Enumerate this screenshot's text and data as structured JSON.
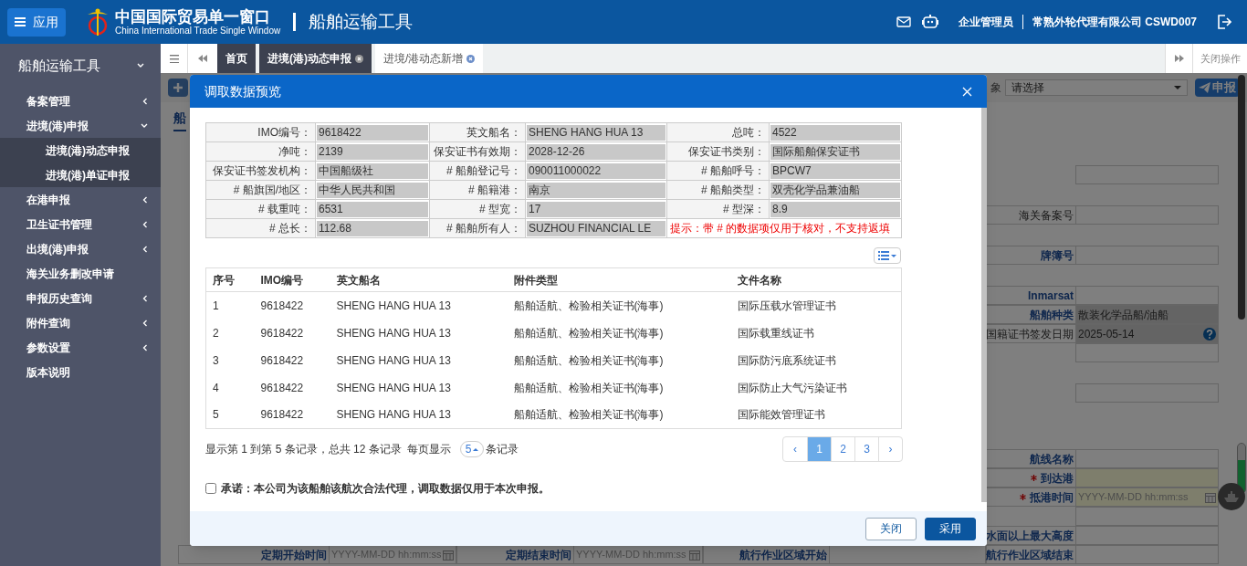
{
  "header": {
    "menu_button": "应用",
    "logo_cn": "中国国际贸易单一窗口",
    "logo_en": "China International Trade Single Window",
    "app_title": "船舶运输工具",
    "user_role": "企业管理员",
    "company": "常熟外轮代理有限公司 CSWD007"
  },
  "sidebar": {
    "title": "船舶运输工具",
    "items": [
      {
        "label": "备案管理",
        "expandable": true
      },
      {
        "label": "进境(港)申报",
        "expandable": true,
        "expanded": true,
        "children": [
          {
            "label": "进境(港)动态申报"
          },
          {
            "label": "进境(港)单证申报"
          }
        ]
      },
      {
        "label": "在港申报",
        "expandable": true
      },
      {
        "label": "卫生证书管理",
        "expandable": true
      },
      {
        "label": "出境(港)申报",
        "expandable": true
      },
      {
        "label": "海关业务删改申请",
        "expandable": false
      },
      {
        "label": "申报历史查询",
        "expandable": true
      },
      {
        "label": "附件查询",
        "expandable": true
      },
      {
        "label": "参数设置",
        "expandable": true
      },
      {
        "label": "版本说明",
        "expandable": false
      }
    ]
  },
  "tabs": [
    {
      "label": "首页",
      "closable": false,
      "selected": false
    },
    {
      "label": "进境(港)动态申报",
      "closable": true,
      "selected": false
    },
    {
      "label": "进境/港动态新增",
      "closable": true,
      "selected": true
    }
  ],
  "tab_bar_action": "关闭操作",
  "toolbar": {
    "target_label": "象",
    "target_select": "请选择",
    "submit_button": "申报"
  },
  "panel_tab": "船",
  "form_groups": [
    {
      "rows": [
        {
          "fields": [
            {
              "kind": "input"
            }
          ]
        }
      ]
    },
    {
      "rows": [
        {
          "fields": [
            {
              "kind": "input",
              "label": "海关备案号",
              "emphasis": false
            }
          ]
        }
      ]
    },
    {
      "rows": [
        {
          "fields": [
            {
              "kind": "input",
              "label": "牌簿号",
              "emphasis": true
            }
          ]
        }
      ]
    },
    {
      "rows": [
        {
          "fields": [
            {
              "kind": "input",
              "label": "Inmarsat",
              "emphasis": true
            }
          ]
        },
        {
          "fields": [
            {
              "kind": "readonly",
              "label": "船舶种类",
              "emphasis": true,
              "value": "散装化学品船/油船"
            }
          ]
        },
        {
          "fields": [
            {
              "kind": "readonly",
              "label": "国籍证书签发日期",
              "emphasis": false,
              "value": "2025-05-14",
              "help": true
            }
          ]
        },
        {
          "fields": [
            {
              "kind": "input"
            }
          ]
        }
      ]
    },
    {
      "rows": [
        {
          "fields": [
            {
              "kind": "input"
            }
          ]
        }
      ]
    },
    {
      "rows": [
        {
          "fields": [
            {
              "kind": "input",
              "label": "航线名称",
              "emphasis": true
            }
          ]
        },
        {
          "fields": [
            {
              "kind": "input",
              "label": "到达港",
              "emphasis": true,
              "required": true
            }
          ]
        },
        {
          "fields": [
            {
              "kind": "date",
              "label": "抵港时间",
              "emphasis": true,
              "required": true,
              "placeholder": "YYYY-MM-DD hh:mm:ss"
            }
          ]
        },
        {
          "fields": [
            {
              "kind": "input"
            }
          ]
        },
        {
          "fields": [
            {
              "kind": "input",
              "label": "水面以上最大高度",
              "emphasis": true
            }
          ]
        },
        {
          "fields": [
            {
              "kind": "date",
              "label": "定期开始时间",
              "emphasis": true,
              "placeholder": "YYYY-MM-DD hh:mm:ss"
            },
            {
              "kind": "date",
              "label": "定期结束时间",
              "emphasis": true,
              "placeholder": "YYYY-MM-DD hh:mm:ss"
            },
            {
              "kind": "input",
              "label": "航行作业区域开始",
              "emphasis": true
            },
            {
              "kind": "input",
              "label": "航行作业区域结束",
              "emphasis": true
            }
          ]
        }
      ]
    }
  ],
  "modal": {
    "title": "调取数据预览",
    "info_rows": [
      {
        "cells": [
          {
            "label": "IMO编号：",
            "value": "9618422"
          },
          {
            "label": "英文船名：",
            "value": "SHENG HANG HUA 13"
          },
          {
            "label": "总吨：",
            "value": "4522"
          }
        ]
      },
      {
        "cells": [
          {
            "label": "净吨：",
            "value": "2139"
          },
          {
            "label": "保安证书有效期：",
            "value": "2028-12-26"
          },
          {
            "label": "保安证书类别：",
            "value": "国际船舶保安证书"
          }
        ]
      },
      {
        "cells": [
          {
            "label": "保安证书签发机构：",
            "value": "中国船级社"
          },
          {
            "label": "# 船舶登记号：",
            "value": "090011000022"
          },
          {
            "label": "# 船舶呼号：",
            "value": "BPCW7"
          }
        ]
      },
      {
        "cells": [
          {
            "label": "# 船旗国/地区：",
            "value": "中华人民共和国"
          },
          {
            "label": "# 船籍港：",
            "value": "南京"
          },
          {
            "label": "# 船舶类型：",
            "value": "双壳化学品兼油船"
          }
        ]
      },
      {
        "cells": [
          {
            "label": "# 载重吨：",
            "value": "6531"
          },
          {
            "label": "# 型宽：",
            "value": "17"
          },
          {
            "label": "# 型深：",
            "value": "8.9"
          }
        ]
      },
      {
        "cells": [
          {
            "label": "# 总长：",
            "value": "112.68"
          },
          {
            "label": "# 船舶所有人：",
            "value": "SUZHOU FINANCIAL LE"
          },
          {
            "note": "提示：带 # 的数据项仅用于核对，不支持返填"
          }
        ]
      }
    ],
    "table": {
      "columns": [
        "序号",
        "IMO编号",
        "英文船名",
        "附件类型",
        "文件名称"
      ],
      "rows": [
        [
          "1",
          "9618422",
          "SHENG HANG HUA 13",
          "船舶适航、检验相关证书(海事)",
          "国际压载水管理证书"
        ],
        [
          "2",
          "9618422",
          "SHENG HANG HUA 13",
          "船舶适航、检验相关证书(海事)",
          "国际载重线证书"
        ],
        [
          "3",
          "9618422",
          "SHENG HANG HUA 13",
          "船舶适航、检验相关证书(海事)",
          "国际防污底系统证书"
        ],
        [
          "4",
          "9618422",
          "SHENG HANG HUA 13",
          "船舶适航、检验相关证书(海事)",
          "国际防止大气污染证书"
        ],
        [
          "5",
          "9618422",
          "SHENG HANG HUA 13",
          "船舶适航、检验相关证书(海事)",
          "国际能效管理证书"
        ]
      ]
    },
    "pagination": {
      "summary": "显示第 1 到第 5 条记录，总共 12 条记录",
      "per_page_label": "每页显示",
      "page_size": "5",
      "per_page_suffix": "条记录",
      "pages": [
        {
          "label": "‹",
          "selected": false
        },
        {
          "label": "1",
          "selected": true
        },
        {
          "label": "2",
          "selected": false
        },
        {
          "label": "3",
          "selected": false
        },
        {
          "label": "›",
          "selected": false
        }
      ]
    },
    "agreement": {
      "label": "承诺：本公司为该船舶该航次合法代理，调取数据仅用于本次申报。",
      "checked": false
    },
    "buttons": [
      {
        "label": "关闭",
        "kind": "secondary"
      },
      {
        "label": "采用",
        "kind": "primary"
      }
    ]
  }
}
